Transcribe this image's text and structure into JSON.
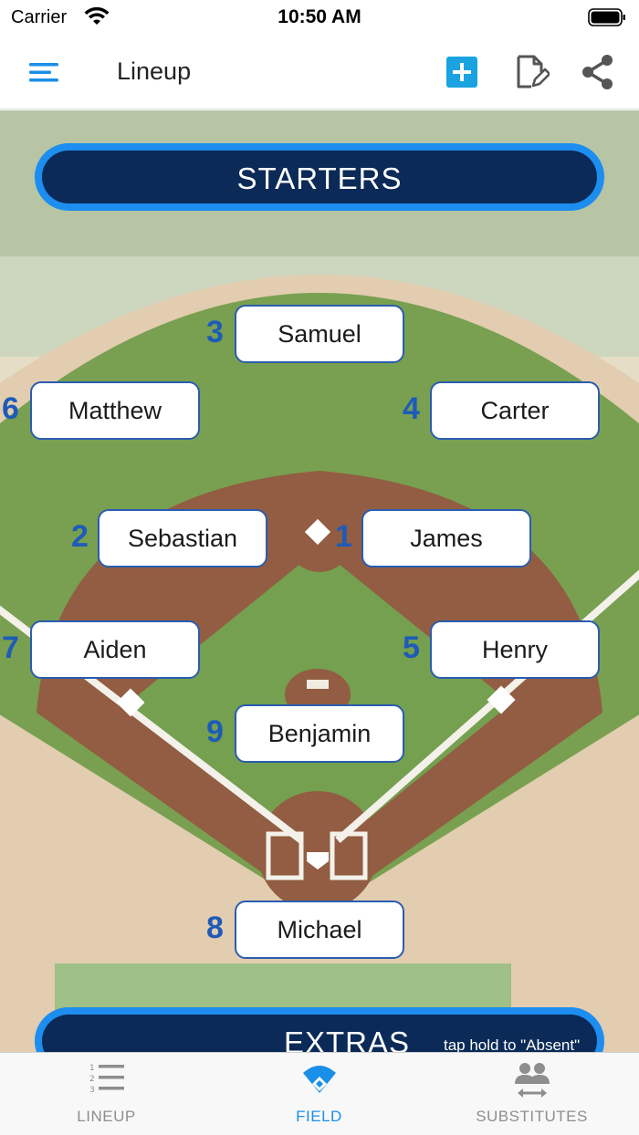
{
  "status_bar": {
    "carrier": "Carrier",
    "time": "10:50 AM"
  },
  "nav": {
    "title": "Lineup"
  },
  "banners": {
    "starters": "STARTERS",
    "extras": "EXTRAS",
    "extras_hint": "tap hold to \"Absent\""
  },
  "players": [
    {
      "position": "3",
      "name": "Samuel"
    },
    {
      "position": "6",
      "name": "Matthew"
    },
    {
      "position": "4",
      "name": "Carter"
    },
    {
      "position": "2",
      "name": "Sebastian"
    },
    {
      "position": "1",
      "name": "James"
    },
    {
      "position": "7",
      "name": "Aiden"
    },
    {
      "position": "5",
      "name": "Henry"
    },
    {
      "position": "9",
      "name": "Benjamin"
    },
    {
      "position": "8",
      "name": "Michael"
    }
  ],
  "tabs": [
    {
      "label": "LINEUP",
      "icon": "numbered-list-icon",
      "active": false
    },
    {
      "label": "FIELD",
      "icon": "baseball-field-icon",
      "active": true
    },
    {
      "label": "SUBSTITUTES",
      "icon": "substitute-swap-icon",
      "active": false
    }
  ],
  "colors": {
    "accent": "#1a8fe8",
    "banner": "#0b2a57",
    "position_number": "#1e5bb8",
    "add_button": "#1aa3e0"
  }
}
